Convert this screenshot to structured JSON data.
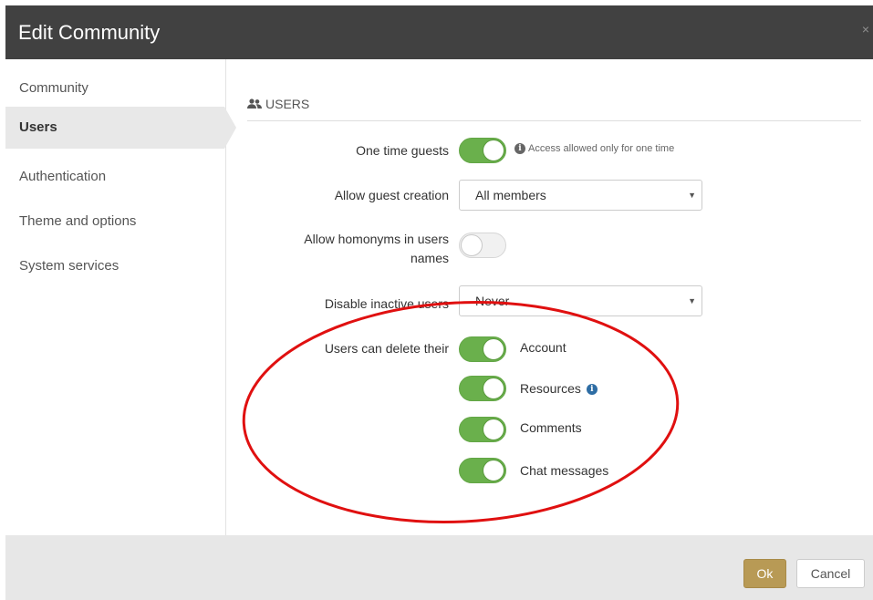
{
  "dialog": {
    "title": "Edit Community",
    "close_glyph": "×"
  },
  "sidebar": {
    "items": [
      {
        "label": "Community",
        "active": false
      },
      {
        "label": "Users",
        "active": true
      },
      {
        "label": "Authentication",
        "active": false
      },
      {
        "label": "Theme and options",
        "active": false
      },
      {
        "label": "System services",
        "active": false
      }
    ]
  },
  "section": {
    "title": "USERS",
    "icon": "users-icon"
  },
  "settings": {
    "one_time_guests": {
      "label": "One time guests",
      "on": true,
      "hint": "Access allowed only for one time",
      "hint_icon": "info-icon"
    },
    "allow_guest_creation": {
      "label": "Allow guest creation",
      "value": "All members"
    },
    "allow_homonyms": {
      "label_line1": "Allow homonyms in users",
      "label_line2": "names",
      "on": false
    },
    "disable_inactive": {
      "label": "Disable inactive users",
      "value": "Never"
    },
    "delete": {
      "label": "Users can delete their",
      "options": [
        {
          "label": "Account",
          "on": true
        },
        {
          "label": "Resources",
          "on": true,
          "info_icon": true
        },
        {
          "label": "Comments",
          "on": true
        },
        {
          "label": "Chat messages",
          "on": true
        }
      ]
    }
  },
  "footer": {
    "ok_label": "Ok",
    "cancel_label": "Cancel"
  },
  "colors": {
    "header_bg": "#414141",
    "toggle_on": "#6ab04c",
    "ok_button": "#b89a55",
    "annotation_ellipse": "#e01010"
  }
}
